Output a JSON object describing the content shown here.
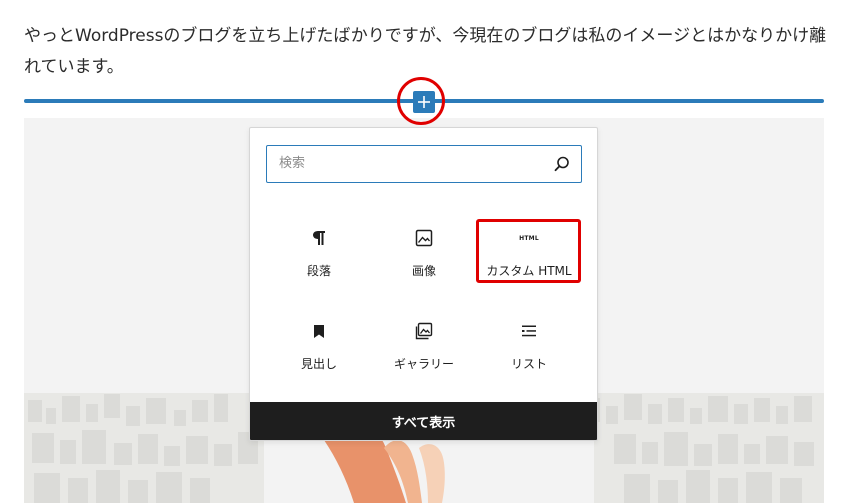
{
  "editor": {
    "paragraph_text": "やっとWordPressのブログを立ち上げたばかりですが、今現在のブログは私のイメージとはかなりかけ離れています。"
  },
  "inserter": {
    "search": {
      "placeholder": "検索",
      "value": ""
    },
    "blocks": [
      {
        "label": "段落",
        "icon": "paragraph-icon"
      },
      {
        "label": "画像",
        "icon": "image-icon"
      },
      {
        "label": "カスタム HTML",
        "icon": "html-icon",
        "icon_text": "HTML",
        "highlighted": true
      },
      {
        "label": "見出し",
        "icon": "heading-bookmark-icon"
      },
      {
        "label": "ギャラリー",
        "icon": "gallery-icon"
      },
      {
        "label": "リスト",
        "icon": "list-icon"
      }
    ],
    "browse_all_label": "すべて表示"
  },
  "colors": {
    "accent": "#2b7bb9",
    "annotation": "#e00000",
    "dark_button": "#1e1e1e"
  }
}
